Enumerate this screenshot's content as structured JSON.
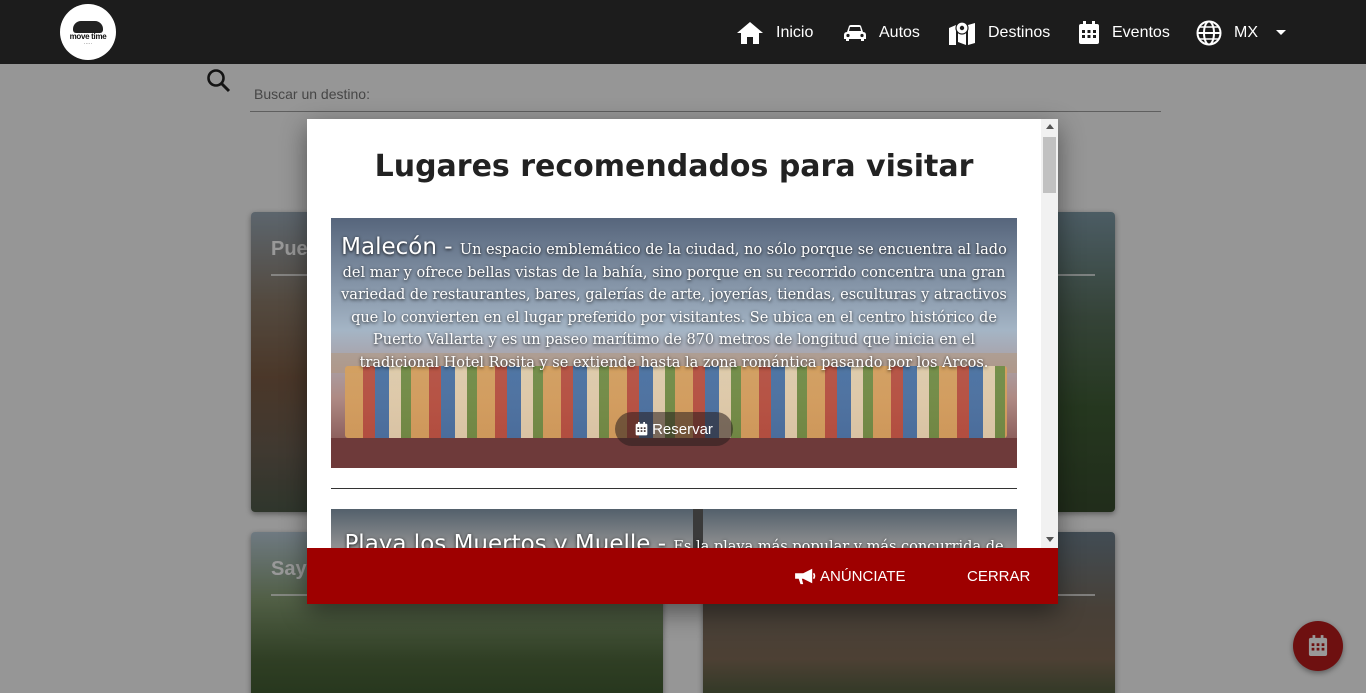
{
  "navbar": {
    "logo_text": "move time",
    "items": [
      {
        "label": "Inicio",
        "icon": "home-icon"
      },
      {
        "label": "Autos",
        "icon": "car-icon"
      },
      {
        "label": "Destinos",
        "icon": "map-pin-icon"
      },
      {
        "label": "Eventos",
        "icon": "calendar-icon"
      },
      {
        "label": "MX",
        "icon": "globe-icon"
      }
    ]
  },
  "search": {
    "placeholder": "Buscar un destino:"
  },
  "cards": [
    {
      "title": "Pue"
    },
    {
      "title": ""
    },
    {
      "title": "Say"
    },
    {
      "title": ""
    }
  ],
  "modal": {
    "title": "Lugares recomendados para visitar",
    "places": [
      {
        "name": "Malecón -",
        "description": "Un espacio emblemático de la ciudad, no sólo porque se encuentra al lado del mar y ofrece bellas vistas de la bahía, sino porque en su recorrido concentra una gran variedad de restaurantes, bares, galerías de arte, joyerías, tiendas, esculturas y atractivos que lo convierten en el lugar preferido por visitantes. Se ubica en el centro histórico de Puerto Vallarta y es un paseo marítimo de 870 metros de longitud que inicia en el tradicional Hotel Rosita y se extiende hasta la zona romántica pasando por los Arcos.",
        "button": "Reservar"
      },
      {
        "name": "Playa los Muertos y Muelle -",
        "description": "Es la playa más popular y más concurrida de la..."
      }
    ],
    "footer": {
      "advertise": "ANÚNCIATE",
      "close": "CERRAR"
    }
  },
  "colors": {
    "navbar": "#1c1c1c",
    "accent": "#9e0000",
    "fab": "#b71c1c"
  }
}
